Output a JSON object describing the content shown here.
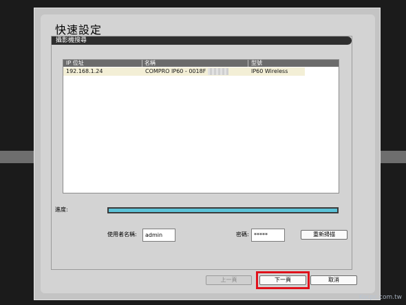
{
  "dialog": {
    "title": "快速設定",
    "section_header": "攝影機搜尋"
  },
  "camera_list": {
    "columns": [
      "IP 位址",
      "名稱",
      "型號"
    ],
    "rows": [
      {
        "ip": "192.168.1.24",
        "name": "COMPRO IP60 - 0018F",
        "model": "IP60 Wireless"
      }
    ]
  },
  "progress": {
    "label": "進度:",
    "value": 1.0
  },
  "credentials": {
    "username_label": "使用者名稱:",
    "username_value": "admin",
    "password_label": "密碼:",
    "password_value": "*****",
    "rescan_button": "重新掃描"
  },
  "footer_buttons": {
    "prev": "上一頁",
    "next": "下一頁",
    "cancel": "取消"
  },
  "watermark": "Kocpc.com.tw"
}
